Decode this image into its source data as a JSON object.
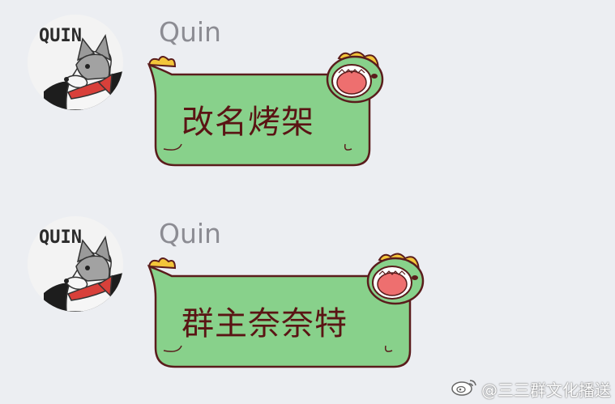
{
  "messages": [
    {
      "sender": "Quin",
      "avatar_text": "QUIN",
      "text": "改名烤架"
    },
    {
      "sender": "Quin",
      "avatar_text": "QUIN",
      "text": "群主奈奈特"
    }
  ],
  "watermark": {
    "text": "@三三群文化播送",
    "icon": "weibo-icon"
  },
  "colors": {
    "background": "#eceef2",
    "bubble_fill": "#88d18b",
    "bubble_outline": "#5a1c1c",
    "bubble_text": "#5a1414",
    "sender": "#8c8c93"
  }
}
